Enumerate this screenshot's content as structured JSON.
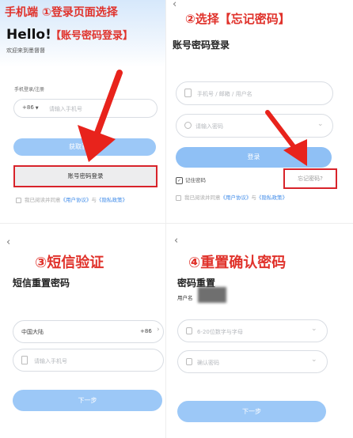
{
  "panel1": {
    "step_title": "手机端 ①登录页面选择",
    "step_subtitle": "【账号密码登录】",
    "greeting": "Hello!",
    "welcome": "欢迎来到墨督督",
    "phone_label": "手机登录/注册",
    "country_code": "+86",
    "phone_placeholder": "请输入手机号",
    "get_code_label": "获取验证码",
    "password_login_label": "账号密码登录",
    "agreement_prefix": "我已阅读并同意",
    "user_agreement": "《用户协议》",
    "and": "与",
    "privacy_policy": "《隐私政策》"
  },
  "panel2": {
    "step_title": "②选择【忘记密码】",
    "page_title": "账号密码登录",
    "account_placeholder": "手机号 / 邮箱 / 用户名",
    "password_placeholder": "请输入密码",
    "login_label": "登录",
    "remember_label": "记住密码",
    "forgot_label": "忘记密码?",
    "agreement_prefix": "我已阅读并同意",
    "user_agreement": "《用户协议》",
    "and": "与",
    "privacy_policy": "《隐私政策》"
  },
  "panel3": {
    "step_title": "③短信验证",
    "page_title": "短信重置密码",
    "region_label": "中国大陆",
    "region_code": "+86",
    "phone_placeholder": "请输入手机号",
    "next_label": "下一步"
  },
  "panel4": {
    "step_title": "④重置确认密码",
    "page_title": "密码重置",
    "username_label": "用户名",
    "new_password_placeholder": "6-20位数字与字母",
    "confirm_placeholder": "确认密码",
    "next_label": "下一步"
  },
  "colors": {
    "accent_red": "#e0322b",
    "button_blue": "#9cc8f7",
    "link_blue": "#3f8be9"
  }
}
